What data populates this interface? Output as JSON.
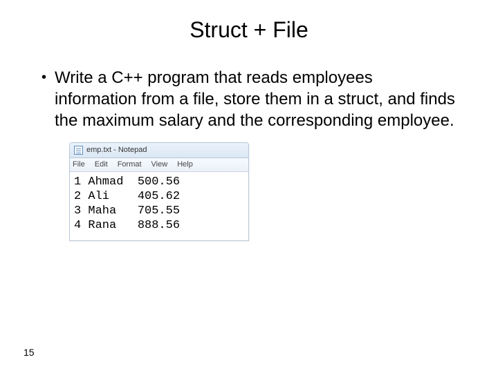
{
  "title": "Struct + File",
  "bullet": "Write a C++ program that reads employees information from a file, store them in a struct, and finds the maximum salary and the corresponding employee.",
  "notepad": {
    "window_title": "emp.txt - Notepad",
    "menu": [
      "File",
      "Edit",
      "Format",
      "View",
      "Help"
    ],
    "rows": [
      {
        "id": 1,
        "name": "Ahmad",
        "salary": "500.56"
      },
      {
        "id": 2,
        "name": "Ali",
        "salary": "405.62"
      },
      {
        "id": 3,
        "name": "Maha",
        "salary": "705.55"
      },
      {
        "id": 4,
        "name": "Rana",
        "salary": "888.56"
      }
    ]
  },
  "page_number": "15"
}
